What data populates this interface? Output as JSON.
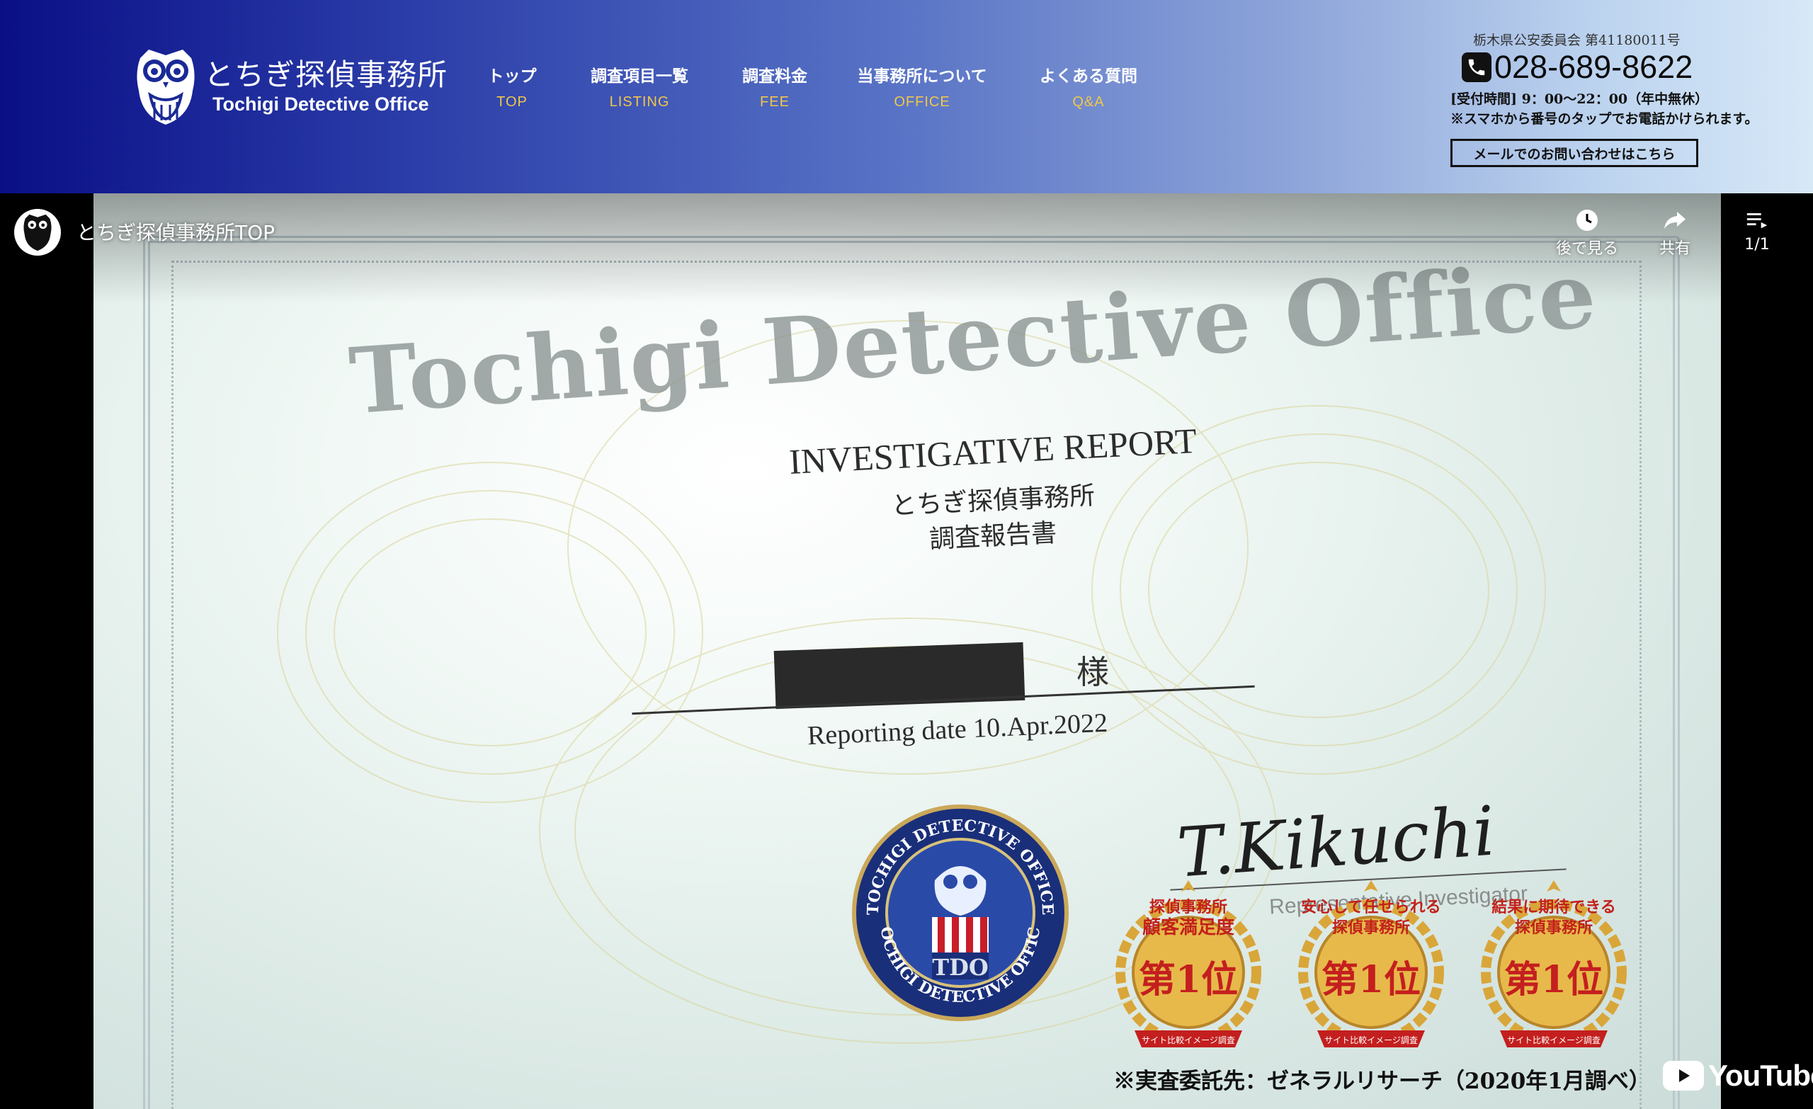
{
  "header": {
    "logo": {
      "name_jp": "とちぎ探偵事務所",
      "name_en": "Tochigi Detective Office"
    },
    "nav": [
      {
        "label_jp": "トップ",
        "label_en": "TOP"
      },
      {
        "label_jp": "調査項目一覧",
        "label_en": "LISTING"
      },
      {
        "label_jp": "調査料金",
        "label_en": "FEE"
      },
      {
        "label_jp": "当事務所について",
        "label_en": "OFFICE"
      },
      {
        "label_jp": "よくある質問",
        "label_en": "Q&A"
      }
    ],
    "contact": {
      "license": "栃木県公安委員会 第41180011号",
      "phone": "028-689-8622",
      "hours": "[受付時間] 9：00〜22：00（年中無休）",
      "tap_note": "※スマホから番号のタップでお電話かけられます。",
      "mail_button": "メールでのお問い合わせはこちら"
    }
  },
  "video": {
    "title": "とちぎ探偵事務所TOP",
    "controls": {
      "watch_later": "後で見る",
      "share": "共有",
      "playlist": "1/1"
    },
    "youtube_logo": "YouTube",
    "document": {
      "office_title": "Tochigi Detective Office",
      "report_title": "INVESTIGATIVE REPORT",
      "office_jp": "とちぎ探偵事務所",
      "report_jp": "調査報告書",
      "honorific": "様",
      "reporting_date": "Reporting date 10.Apr.2022",
      "signature": "T.Kikuchi",
      "signer_title": "Representative Investigator",
      "seal": {
        "ring_top": "TOCHIGI DETECTIVE OFFICE",
        "ring_bottom": "TOCHIGI DETECTIVE OFFICE",
        "center": "TDO"
      }
    },
    "badges": [
      {
        "line1": "探偵事務所",
        "line2": "顧客満足度",
        "rank": "第1位",
        "ribbon": "サイト比較イメージ調査"
      },
      {
        "line1": "安心して任せられる",
        "line2": "探偵事務所",
        "rank": "第1位",
        "ribbon": "サイト比較イメージ調査"
      },
      {
        "line1": "結果に期待できる",
        "line2": "探偵事務所",
        "rank": "第1位",
        "ribbon": "サイト比較イメージ調査"
      }
    ],
    "survey_note": "※実査委託先：ゼネラルリサーチ（2020年1月調べ）"
  }
}
